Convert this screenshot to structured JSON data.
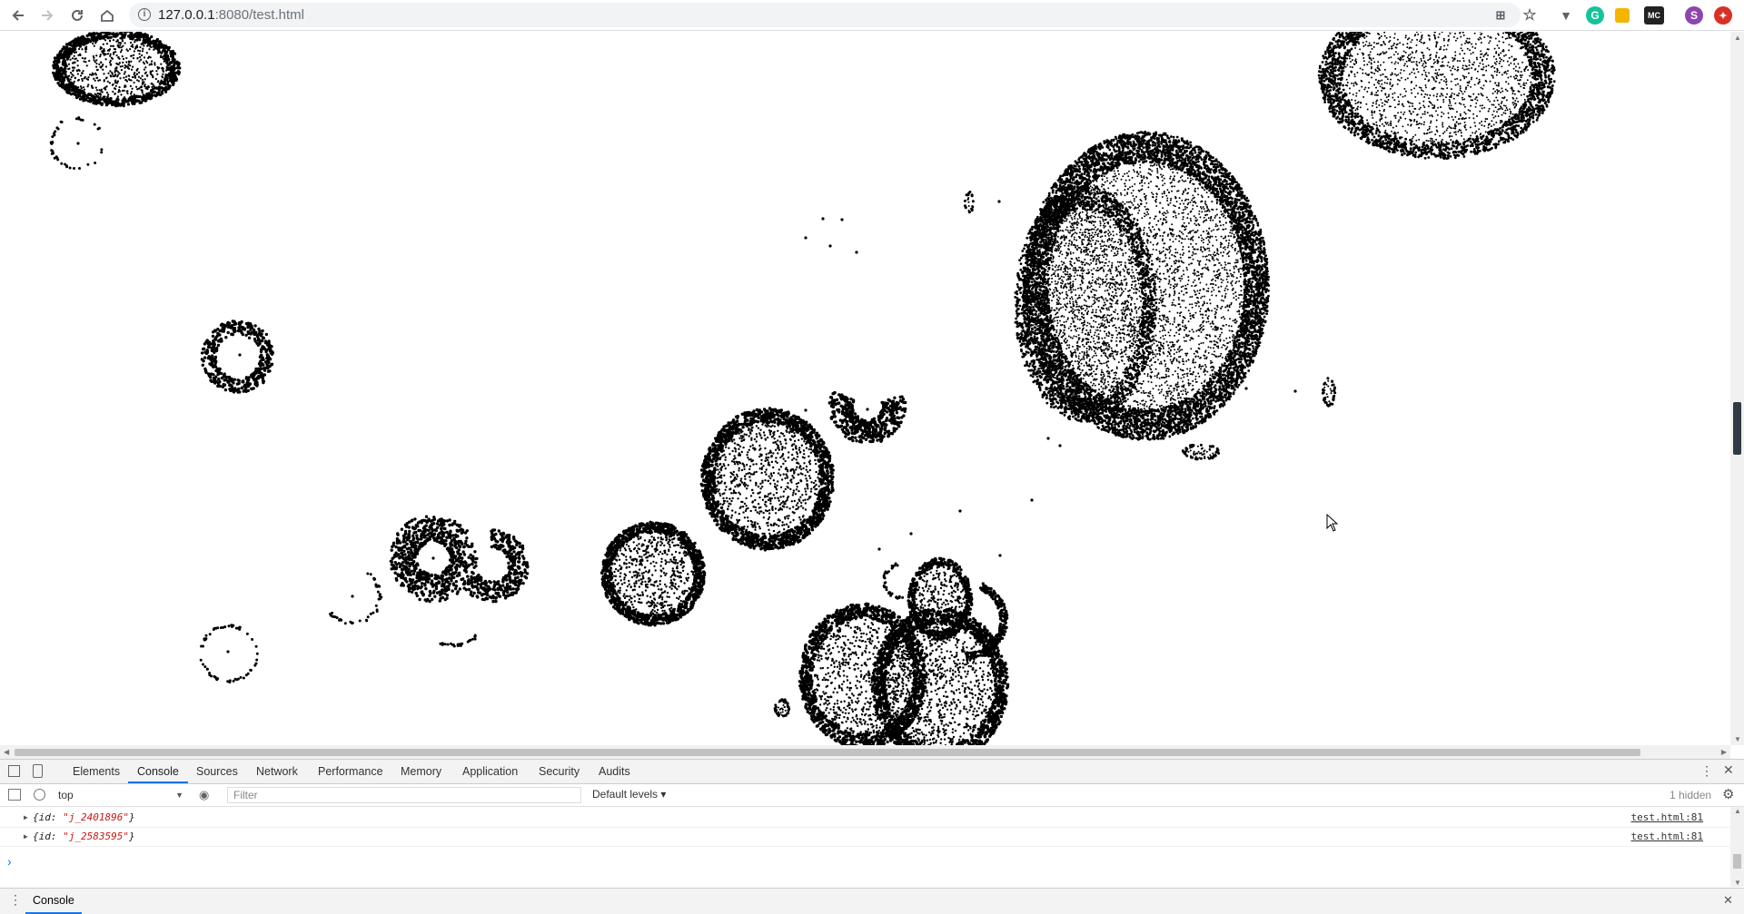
{
  "browser": {
    "url_host": "127.0.0.1",
    "url_rest": ":8080/test.html",
    "avatar_letter": "S"
  },
  "canvas": {
    "description": "particle blobs",
    "dot_color": "#000000"
  },
  "devtools": {
    "tabs": [
      "Elements",
      "Console",
      "Sources",
      "Network",
      "Performance",
      "Memory",
      "Application",
      "Security",
      "Audits"
    ],
    "active_tab": "Console",
    "context": "top",
    "filter_placeholder": "Filter",
    "levels": "Default levels ▾",
    "hidden_count": "1 hidden",
    "messages": [
      {
        "prefix": "{id: ",
        "value": "\"j_2401896\"",
        "suffix": "}",
        "source": "test.html:81"
      },
      {
        "prefix": "{id: ",
        "value": "\"j_2583595\"",
        "suffix": "}",
        "source": "test.html:81"
      }
    ],
    "prompt": "›",
    "drawer_tab": "Console"
  },
  "colors": {
    "accent": "#1a73e8",
    "grammarly": "#15c39a",
    "avatar": "#8e44ad",
    "red_ext": "#d93025"
  }
}
